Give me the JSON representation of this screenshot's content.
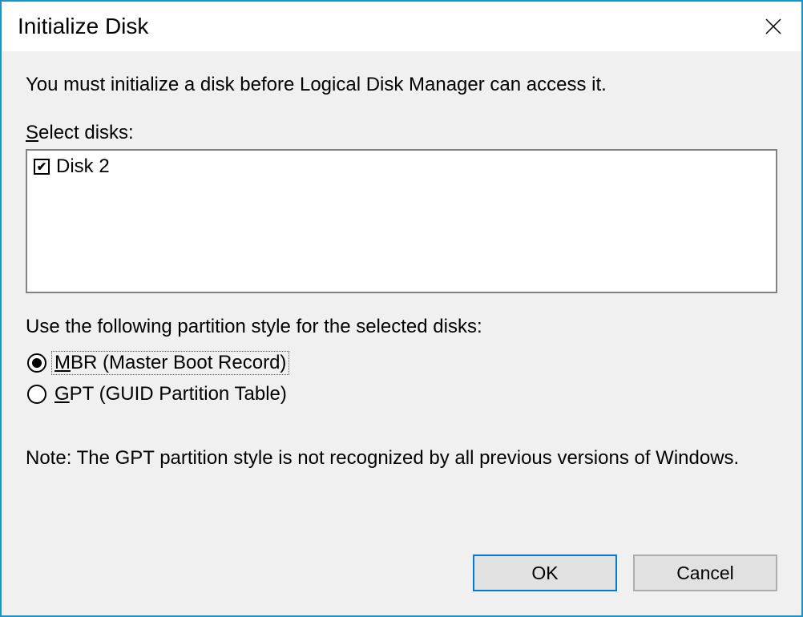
{
  "titlebar": {
    "title": "Initialize Disk"
  },
  "content": {
    "instruction": "You must initialize a disk before Logical Disk Manager can access it.",
    "select_disks_label_pre": "S",
    "select_disks_label_rest": "elect disks:",
    "disks": [
      {
        "label": "Disk 2",
        "checked": true
      }
    ],
    "partition_label": "Use the following partition style for the selected disks:",
    "options": {
      "mbr": {
        "pre": "M",
        "rest": "BR (Master Boot Record)",
        "selected": true,
        "focused": true
      },
      "gpt": {
        "pre": "G",
        "rest": "PT (GUID Partition Table)",
        "selected": false,
        "focused": false
      }
    },
    "note": "Note: The GPT partition style is not recognized by all previous versions of Windows."
  },
  "buttons": {
    "ok": "OK",
    "cancel": "Cancel"
  }
}
